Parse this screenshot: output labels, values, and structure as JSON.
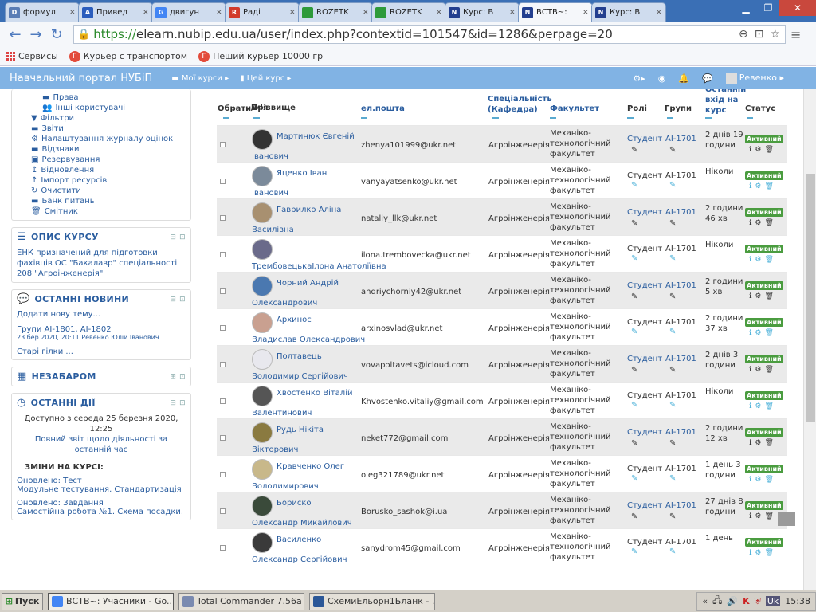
{
  "browser": {
    "tabs": [
      {
        "label": "формул",
        "favcolor": "#5a7db5",
        "favtext": "D"
      },
      {
        "label": "Привед",
        "favcolor": "#2b5dbd",
        "favtext": "A"
      },
      {
        "label": "двигун",
        "favcolor": "#4285f4",
        "favtext": "G"
      },
      {
        "label": "Раді",
        "favcolor": "#d23b2b",
        "favtext": "R"
      },
      {
        "label": "ROZETK",
        "favcolor": "#2e9a3a",
        "favtext": ""
      },
      {
        "label": "ROZETK",
        "favcolor": "#2e9a3a",
        "favtext": ""
      },
      {
        "label": "Курс: В",
        "favcolor": "#233f8f",
        "favtext": "N"
      },
      {
        "label": "ВСТВ~:",
        "favcolor": "#233f8f",
        "favtext": "N"
      },
      {
        "label": "Курс: В",
        "favcolor": "#233f8f",
        "favtext": "N"
      }
    ],
    "url_scheme": "https://",
    "url_rest": "elearn.nubip.edu.ua/user/index.php?contextid=101547&id=1286&perpage=20",
    "bookmarks": [
      {
        "label": "Сервисы"
      },
      {
        "label": "Курьер с транспортом"
      },
      {
        "label": "Пеший курьер 10000 гр"
      }
    ]
  },
  "moodle": {
    "site_name": "Навчальний портал НУБіП",
    "my_courses": "Мої курси",
    "this_course": "Цей курс",
    "user_name": "Ревенко"
  },
  "sidebar": {
    "admin_items": [
      {
        "icon": "▬",
        "label": "Права",
        "indent": true
      },
      {
        "icon": "👥",
        "label": "Інші користувачі",
        "indent": true
      },
      {
        "icon": "▼",
        "label": "Фільтри",
        "indent": false
      },
      {
        "icon": "▬",
        "label": "Звіти",
        "indent": false
      },
      {
        "icon": "⚙",
        "label": "Налаштування журналу оцінок",
        "indent": false
      },
      {
        "icon": "▬",
        "label": "Відзнаки",
        "indent": false
      },
      {
        "icon": "▣",
        "label": "Резервування",
        "indent": false
      },
      {
        "icon": "↥",
        "label": "Відновлення",
        "indent": false
      },
      {
        "icon": "↥",
        "label": "Імпорт ресурсів",
        "indent": false
      },
      {
        "icon": "↻",
        "label": "Очистити",
        "indent": false
      },
      {
        "icon": "▬",
        "label": "Банк питань",
        "indent": false
      },
      {
        "icon": "🗑",
        "label": "Смітник",
        "indent": false
      }
    ],
    "course_desc_title": "ОПИС КУРСУ",
    "course_desc_text": "ЕНК призначений для підготовки фахівців ОС \"Бакалавр\" спеціальності 208 \"Агроінженерія\"",
    "news_title": "ОСТАННІ НОВИНИ",
    "news_add": "Додати нову тему...",
    "news_item": "Групи АІ-1801, АІ-1802",
    "news_meta": "23 бер 2020, 20:11 Ревенко Юлій Іванович",
    "news_old": "Старі гілки ...",
    "upcoming_title": "НЕЗАБАРОМ",
    "recent_title": "ОСТАННІ ДІЇ",
    "recent_since": "Доступно з середа 25 березня 2020, 12:25",
    "recent_report": "Повний звіт щодо діяльності за останній час",
    "recent_changes": "ЗМІНИ НА КУРСІ:",
    "recent_upd1": "Оновлено: Тест",
    "recent_upd1_text": "Модульне тестування. Стандартизація",
    "recent_upd2": "Оновлено: Завдання",
    "recent_upd2_text": "Самостійна робота №1. Схема посадки."
  },
  "table": {
    "headers": {
      "select": "Обрати",
      "surname": "Прізвище",
      "sep": "/",
      "firstname": "Ім'я",
      "sort_icon": "▲",
      "email": "ел.пошта",
      "specialty": "Спеціальність (Кафедра)",
      "faculty": "Факультет",
      "roles": "Ролі",
      "groups": "Групи",
      "last_access": "Останній вхід на курс",
      "status": "Статус"
    },
    "rows": [
      {
        "name1": "Мартинюк Євгеній",
        "name2": "Іванович",
        "email": "zhenya101999@ukr.net",
        "spec": "Агроінженерія",
        "fac": "Механіко-технологічний факультет",
        "role": "Студент",
        "group": "АІ-1701",
        "last": "2 днів 19 години",
        "status": "Активний",
        "color": "#333"
      },
      {
        "name1": "Яценко Іван",
        "name2": "Іванович",
        "email": "vanyayatsenko@ukr.net",
        "spec": "Агроінженерія",
        "fac": "Механіко-технологічний факультет",
        "role": "Студент",
        "group": "АІ-1701",
        "last": "Ніколи",
        "status": "Активний",
        "color": "#7b8a9a"
      },
      {
        "name1": "Гаврилко Аліна",
        "name2": "Василівна",
        "email": "nataliy_llk@ukr.net",
        "spec": "Агроінженерія",
        "fac": "Механіко-технологічний факультет",
        "role": "Студент",
        "group": "АІ-1701",
        "last": "2 години 46 хв",
        "status": "Активний",
        "color": "#a89070"
      },
      {
        "name1": "",
        "name2": "ТрембовецькаІлона Анатоліївна",
        "email": "ilona.trembovecka@ukr.net",
        "spec": "Агроінженерія",
        "fac": "Механіко-технологічний факультет",
        "role": "Студент",
        "group": "АІ-1701",
        "last": "Ніколи",
        "status": "Активний",
        "color": "#6a6a8a"
      },
      {
        "name1": "Чорний Андрій",
        "name2": "Олександрович",
        "email": "andriychorniy42@ukr.net",
        "spec": "Агроінженерія",
        "fac": "Механіко-технологічний факультет",
        "role": "Студент",
        "group": "АІ-1701",
        "last": "2 години 5 хв",
        "status": "Активний",
        "color": "#4a78b0"
      },
      {
        "name1": "Архинос",
        "name2": "Владислав Олександрович",
        "email": "arxinosvlad@ukr.net",
        "spec": "Агроінженерія",
        "fac": "Механіко-технологічний факультет",
        "role": "Студент",
        "group": "АІ-1701",
        "last": "2 години 37 хв",
        "status": "Активний",
        "color": "#c9a090"
      },
      {
        "name1": "Полтавець",
        "name2": "Володимир Сергійович",
        "email": "vovapoltavets@icloud.com",
        "spec": "Агроінженерія",
        "fac": "Механіко-технологічний факультет",
        "role": "Студент",
        "group": "АІ-1701",
        "last": "2 днів 3 години",
        "status": "Активний",
        "color": "#e8e8ee"
      },
      {
        "name1": "Хвостенко Віталій",
        "name2": "Валентинович",
        "email": "Khvostenko.vitaliy@gmail.com",
        "spec": "Агроінженерія",
        "fac": "Механіко-технологічний факультет",
        "role": "Студент",
        "group": "АІ-1701",
        "last": "Ніколи",
        "status": "Активний",
        "color": "#555"
      },
      {
        "name1": "Рудь Нікіта",
        "name2": "Вікторович",
        "email": "neket772@gmail.com",
        "spec": "Агроінженерія",
        "fac": "Механіко-технологічний факультет",
        "role": "Студент",
        "group": "АІ-1701",
        "last": "2 години 12 хв",
        "status": "Активний",
        "color": "#8a7a40"
      },
      {
        "name1": "Кравченко Олег",
        "name2": "Володимирович",
        "email": "oleg321789@ukr.net",
        "spec": "Агроінженерія",
        "fac": "Механіко-технологічний факультет",
        "role": "Студент",
        "group": "АІ-1701",
        "last": "1 день 3 години",
        "status": "Активний",
        "color": "#c8b88a"
      },
      {
        "name1": "Бориско",
        "name2": "Олександр Микайлович",
        "email": "Borusko_sashok@i.ua",
        "spec": "Агроінженерія",
        "fac": "Механіко-технологічний факультет",
        "role": "Студент",
        "group": "АІ-1701",
        "last": "27 днів 8 години",
        "status": "Активний",
        "color": "#3a4a3a"
      },
      {
        "name1": "Василенко",
        "name2": "Олександр Сергійович",
        "email": "sanydrom45@gmail.com",
        "spec": "Агроінженерія",
        "fac": "Механіко-технологічний факультет",
        "role": "Студент",
        "group": "АІ-1701",
        "last": "1 день",
        "status": "Активний",
        "color": "#3a3a3a"
      }
    ]
  },
  "taskbar": {
    "start": "Пуск",
    "items": [
      {
        "label": "ВСТВ~: Учасники - Go...",
        "color": "#4285f4"
      },
      {
        "label": "Total Commander 7.56a ...",
        "color": "#7a8ab0"
      },
      {
        "label": "СхемиЕльорн1Бланк - ...",
        "color": "#2b5797"
      }
    ],
    "clock": "15:38"
  }
}
